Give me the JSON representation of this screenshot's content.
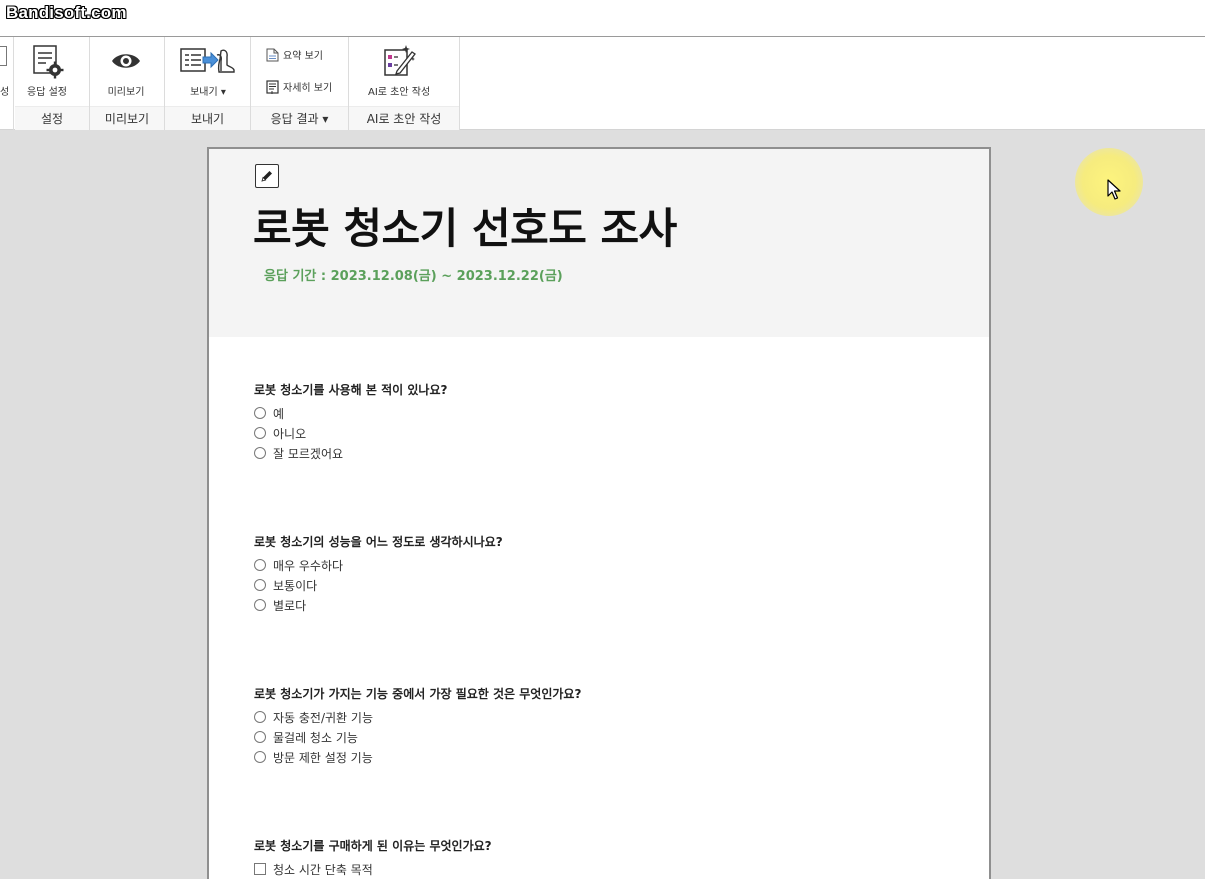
{
  "watermark": "Bandisoft.com",
  "ribbon": {
    "stub_label": "성",
    "groups": {
      "settings": {
        "label": "설정",
        "button": "응답 설정"
      },
      "preview": {
        "label": "미리보기",
        "button": "미리보기"
      },
      "send": {
        "label": "보내기",
        "button": "보내기"
      },
      "results": {
        "label": "응답 결과",
        "summary": "요약 보기",
        "detail": "자세히 보기"
      },
      "ai": {
        "label": "AI로 초안 작성",
        "button": "AI로 초안 작성"
      }
    }
  },
  "survey": {
    "title": "로봇 청소기 선호도 조사",
    "period": "응답 기간 : 2023.12.08(금) ~ 2023.12.22(금)",
    "questions": [
      {
        "title": "로봇 청소기를 사용해 본 적이 있나요?",
        "type": "radio",
        "options": [
          "예",
          "아니오",
          "잘 모르겠어요"
        ]
      },
      {
        "title": "로봇 청소기의 성능을 어느 정도로 생각하시나요?",
        "type": "radio",
        "options": [
          "매우 우수하다",
          "보통이다",
          "별로다"
        ]
      },
      {
        "title": "로봇 청소기가 가지는 기능 중에서 가장 필요한 것은 무엇인가요?",
        "type": "radio",
        "options": [
          "자동 충전/귀환 기능",
          "물걸레 청소 기능",
          "방문 제한 설정 기능"
        ]
      },
      {
        "title": "로봇 청소기를 구매하게 된 이유는 무엇인가요?",
        "type": "checkbox",
        "options": [
          "청소 시간 단축 목적"
        ]
      }
    ]
  },
  "colors": {
    "period_text": "#5ba05b",
    "canvas": "#dedede",
    "cursor_highlight": "#f7ee7a"
  }
}
